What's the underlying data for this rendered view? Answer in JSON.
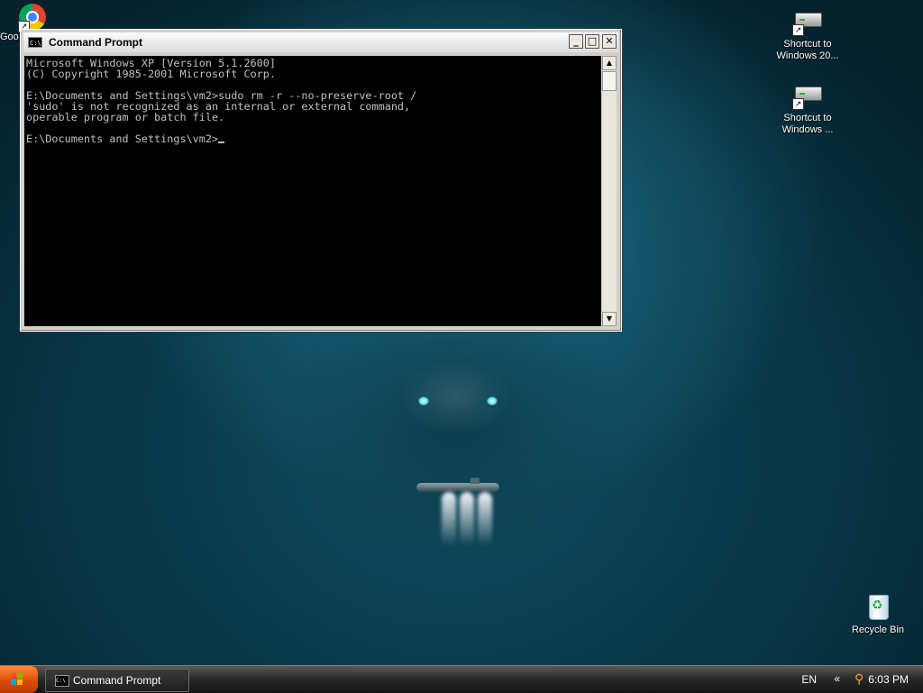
{
  "desktop": {
    "icons": [
      {
        "label": "Goo",
        "icon": "chrome-icon"
      },
      {
        "label": "Shortcut to Windows 20...",
        "icon": "drive-icon"
      },
      {
        "label": "Shortcut to Windows ...",
        "icon": "drive-icon"
      },
      {
        "label": "Recycle Bin",
        "icon": "recycle-bin-icon"
      }
    ]
  },
  "window": {
    "title": "Command Prompt",
    "buttons": {
      "minimize": "_",
      "maximize": "□",
      "close": "✕"
    },
    "console_lines": [
      "Microsoft Windows XP [Version 5.1.2600]",
      "(C) Copyright 1985-2001 Microsoft Corp.",
      "",
      "E:\\Documents and Settings\\vm2>sudo rm -r --no-preserve-root /",
      "'sudo' is not recognized as an internal or external command,",
      "operable program or batch file.",
      "",
      "E:\\Documents and Settings\\vm2>"
    ],
    "colors": {
      "console_bg": "#000000",
      "console_text": "#c0c0c0"
    }
  },
  "taskbar": {
    "task_label": "Command Prompt",
    "language": "EN",
    "clock": "6:03 PM",
    "tray_chevron": "«"
  }
}
